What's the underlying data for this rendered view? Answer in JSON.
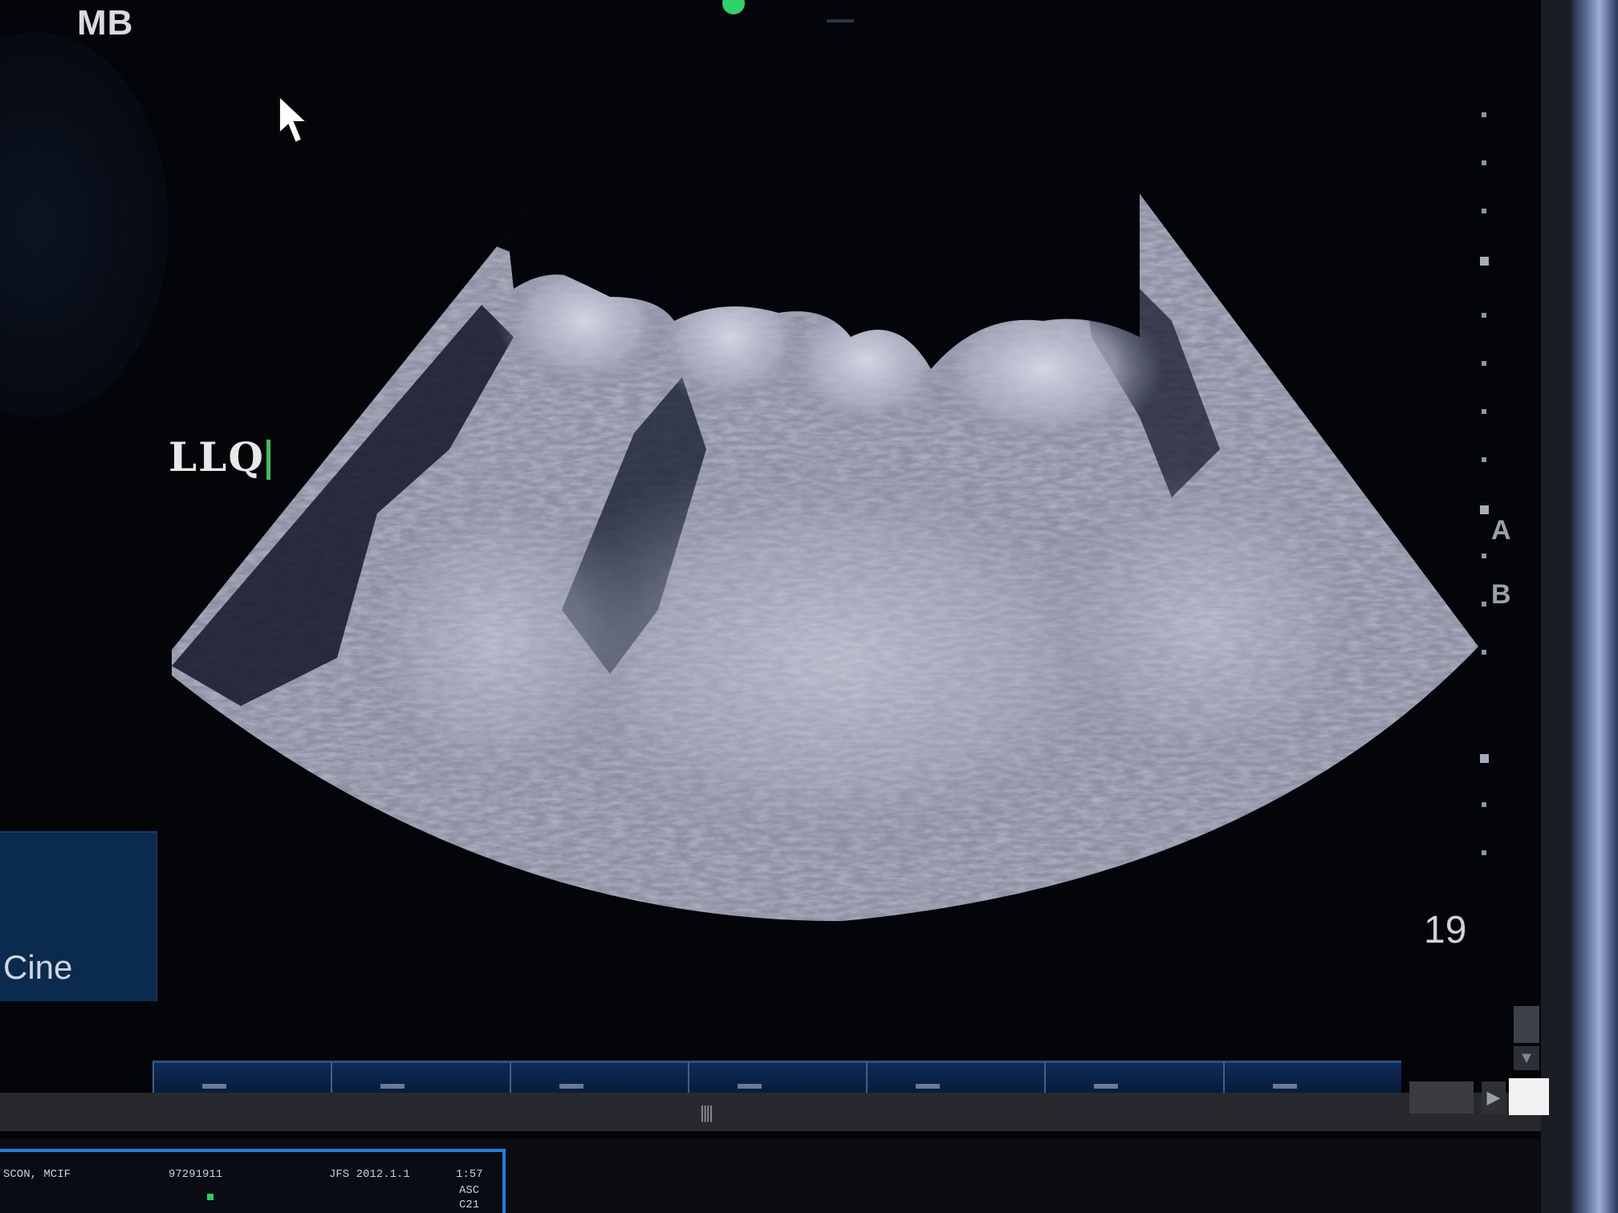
{
  "header": {
    "mode_label": "MB"
  },
  "image": {
    "annotation_text": "LLQ",
    "frame_number": "19"
  },
  "side_scale": {
    "letters": [
      "A",
      "B"
    ]
  },
  "left_panel": {
    "cine_label": "Cine"
  },
  "softkey_bar": {
    "tabs": [
      "",
      "",
      "",
      "",
      "",
      "",
      ""
    ]
  },
  "taskbar": {
    "item_text_1": "SCON, MCIF",
    "item_text_2": "97291911",
    "item_text_3": "JFS 2012.1.1",
    "item_text_4": "1:57",
    "item_text_5": "ASC",
    "item_text_6": "C21"
  },
  "colors": {
    "cine_panel": "#0a2a4e",
    "indicator_green": "#31d26b",
    "taskbar_highlight": "#1f7ee0"
  }
}
